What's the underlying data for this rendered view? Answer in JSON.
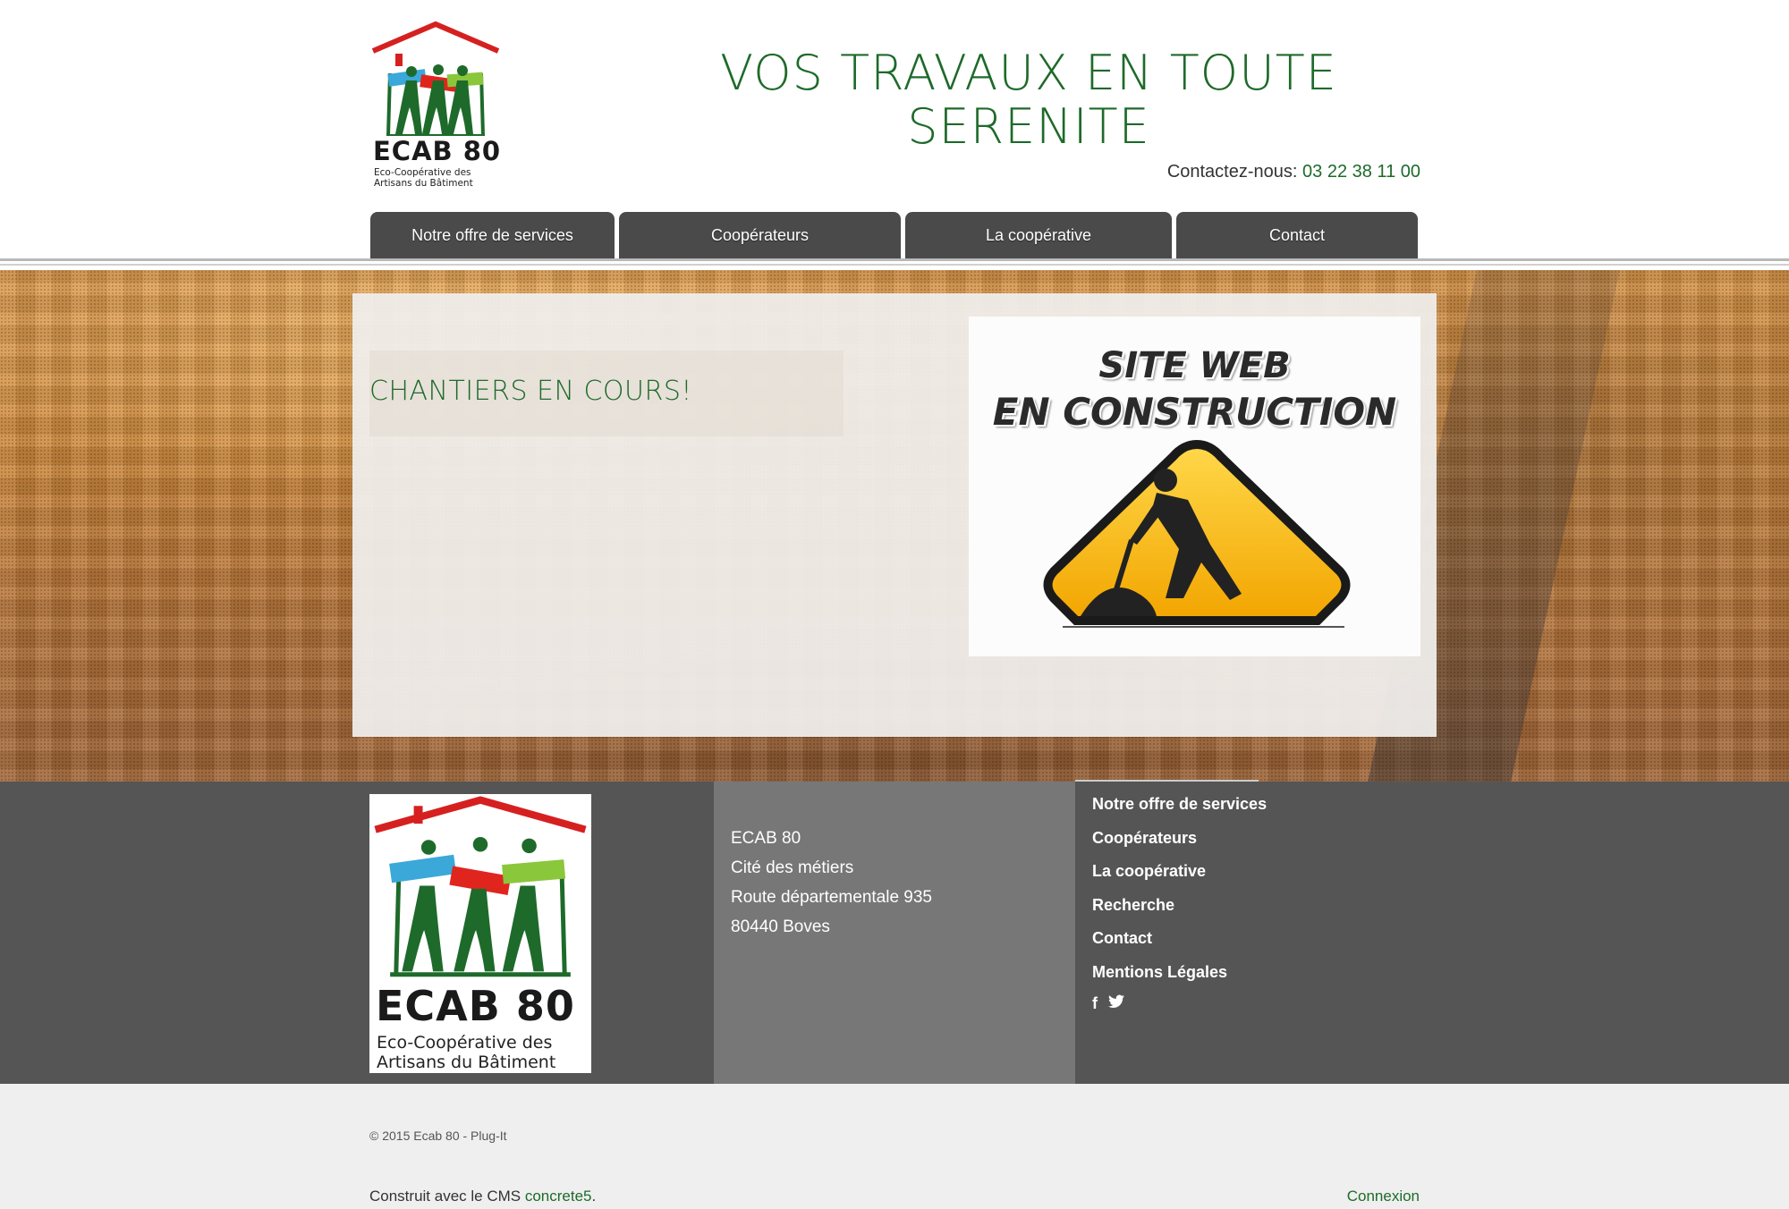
{
  "header": {
    "brand": "ECAB 80",
    "tagline_line1": "Eco-Coopérative des",
    "tagline_line2": "Artisans du Bâtiment",
    "headline_line1": "VOS TRAVAUX EN TOUTE",
    "headline_line2": "SERENITE",
    "contact_label": "Contactez-nous:",
    "contact_phone": "03 22 38 11 00"
  },
  "nav": {
    "items": [
      {
        "label": "Notre offre de services"
      },
      {
        "label": "Coopérateurs"
      },
      {
        "label": "La coopérative"
      },
      {
        "label": "Contact"
      }
    ]
  },
  "main": {
    "title": "CHANTIERS EN COURS!",
    "image_text_line1": "SITE WEB",
    "image_text_line2": "EN CONSTRUCTION"
  },
  "footer": {
    "logo_brand": "ECAB 80",
    "logo_tagline_line1": "Eco-Coopérative des",
    "logo_tagline_line2": "Artisans du Bâtiment",
    "address": [
      "ECAB 80",
      "Cité des métiers",
      "Route départementale 935",
      "80440 Boves"
    ],
    "links": [
      "Notre offre de services",
      "Coopérateurs",
      "La coopérative",
      "Recherche",
      "Contact",
      "Mentions Légales"
    ],
    "social": {
      "facebook_glyph": "f",
      "twitter_glyph": "🐦"
    },
    "copyright": "© 2015 Ecab 80 - Plug-It",
    "built_prefix": "Construit avec le CMS ",
    "built_link": "concrete5",
    "built_suffix": ".",
    "login": "Connexion"
  },
  "colors": {
    "accent_green": "#1e6a2a",
    "nav_bg": "#4a4a4a",
    "footer_bg": "#555555",
    "footer_mid": "#777777"
  },
  "icons": [
    "facebook-icon",
    "twitter-icon",
    "house-logo-icon",
    "construction-sign-icon"
  ]
}
